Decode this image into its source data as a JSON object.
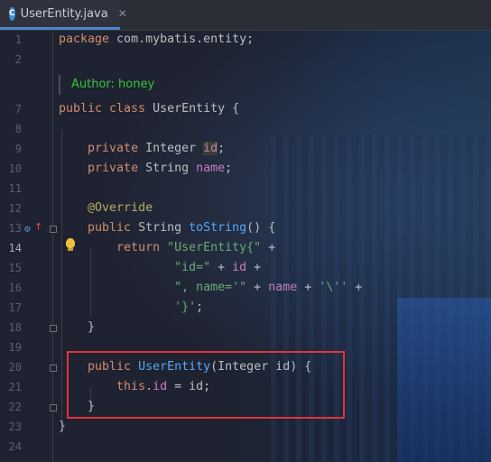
{
  "tab": {
    "icon_letter": "C",
    "title": "UserEntity.java",
    "close": "✕"
  },
  "author": "Author: honey",
  "code_lines": [
    {
      "n": "1",
      "html": "<span class='kw'>package</span> com.mybatis.entity;"
    },
    {
      "n": "2",
      "html": ""
    },
    {
      "n": "7",
      "html": "<span class='kw'>public class</span> UserEntity {"
    },
    {
      "n": "8",
      "html": ""
    },
    {
      "n": "9",
      "html": "    <span class='kw'>private</span> Integer <span class='fld hl'>id</span>;"
    },
    {
      "n": "10",
      "html": "    <span class='kw'>private</span> String <span class='fld'>name</span>;"
    },
    {
      "n": "11",
      "html": ""
    },
    {
      "n": "12",
      "html": "    <span class='ann'>@Override</span>"
    },
    {
      "n": "13",
      "html": "    <span class='kw'>public</span> String <span class='fn'>toString</span>() {"
    },
    {
      "n": "14",
      "html": "        <span class='kw'>return</span> <span class='str'>\"UserEntity{\"</span> +"
    },
    {
      "n": "15",
      "html": "                <span class='str'>\"id=\"</span> + <span class='fld'>id</span> +"
    },
    {
      "n": "16",
      "html": "                <span class='str'>\", name='\"</span> + <span class='fld'>name</span> + <span class='str'>'\\''</span> +"
    },
    {
      "n": "17",
      "html": "                <span class='str'>'}'</span>;"
    },
    {
      "n": "18",
      "html": "    }"
    },
    {
      "n": "19",
      "html": ""
    },
    {
      "n": "20",
      "html": "    <span class='kw'>public</span> <span class='fn'>UserEntity</span>(Integer id) {"
    },
    {
      "n": "21",
      "html": "        <span class='kw'>this</span>.<span class='fld'>id</span> = id;"
    },
    {
      "n": "22",
      "html": "    }"
    },
    {
      "n": "23",
      "html": "}"
    },
    {
      "n": "24",
      "html": ""
    }
  ],
  "current_line": "14",
  "colors": {
    "keyword": "#cf8e6d",
    "string": "#6aab73",
    "field": "#c77dbb",
    "method": "#56a8f5",
    "annotation": "#b3ae60",
    "highlight_box": "#e0343c"
  }
}
